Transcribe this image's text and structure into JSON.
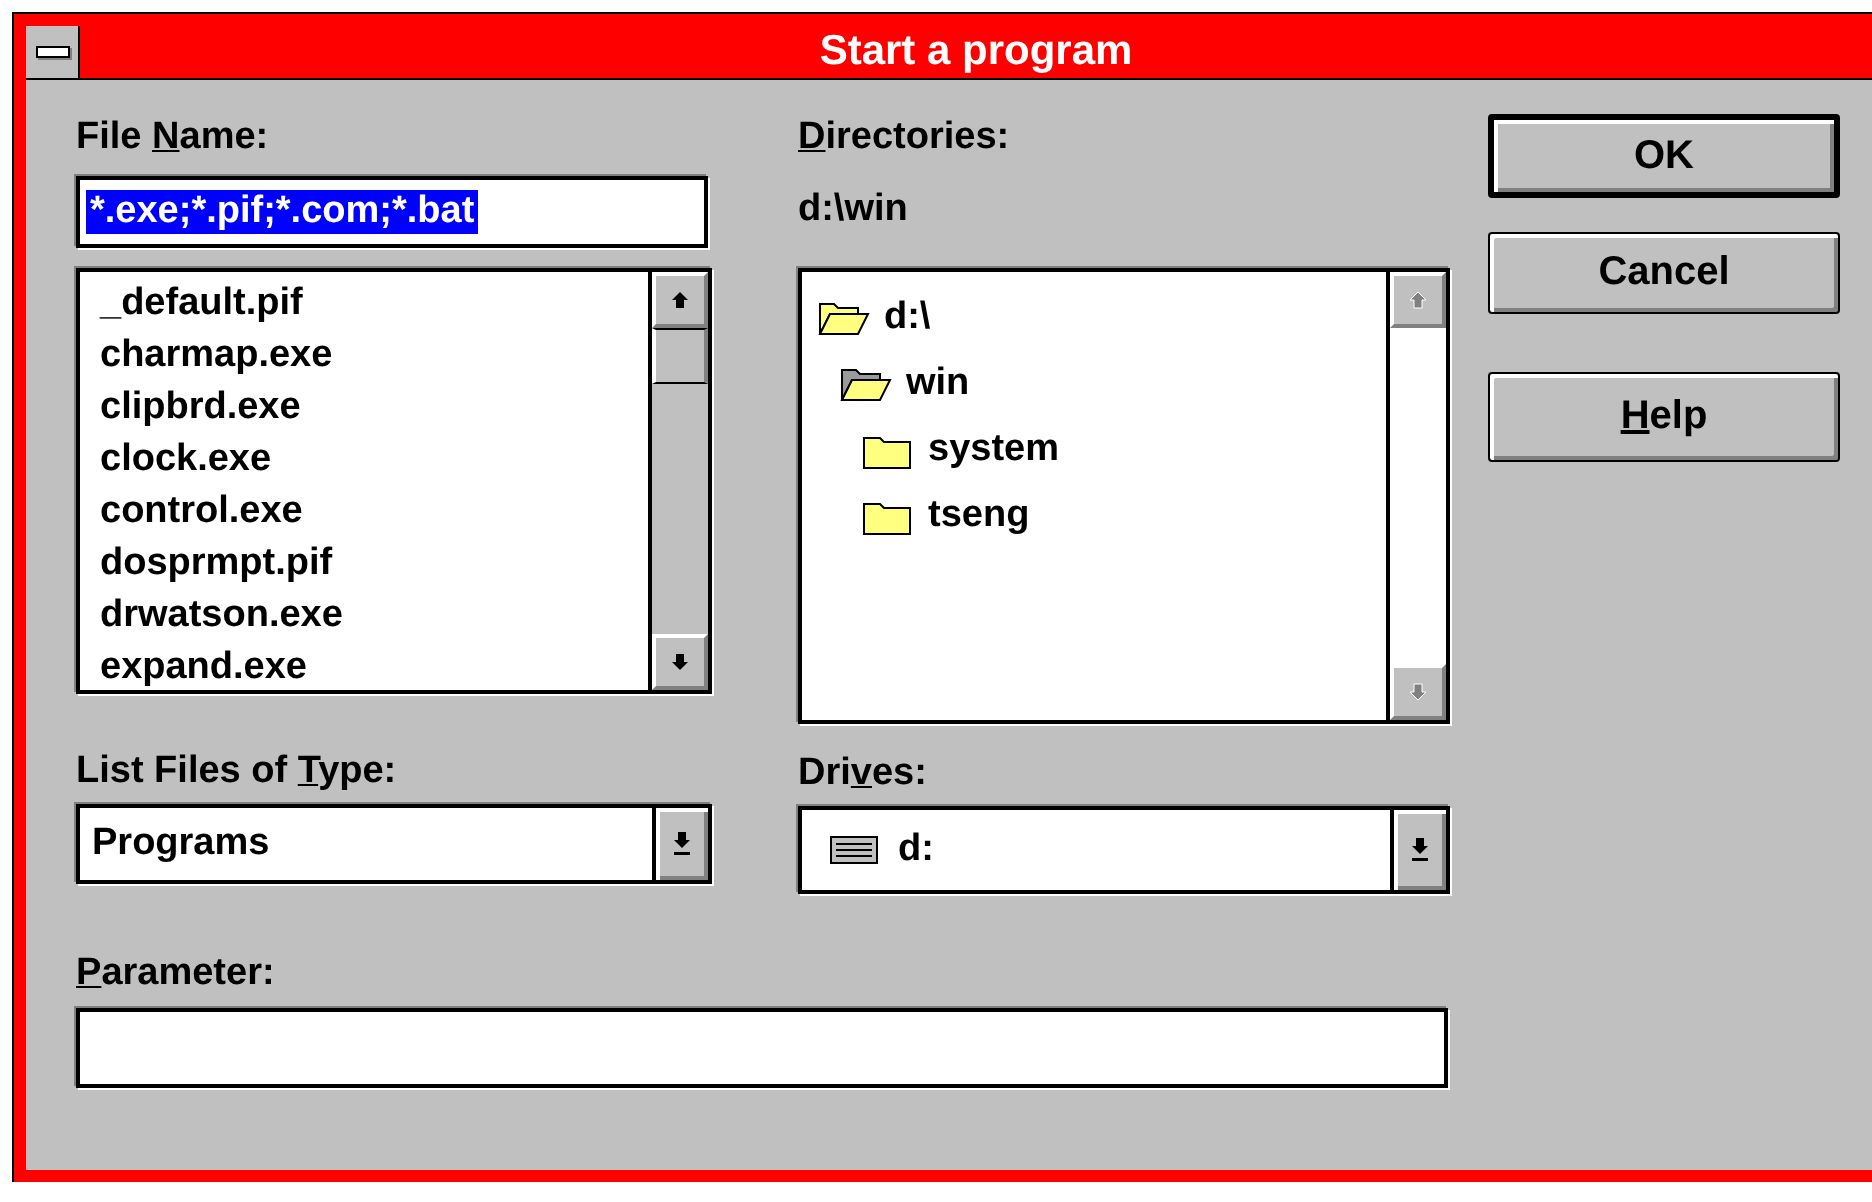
{
  "window": {
    "title": "Start a program"
  },
  "file_name": {
    "label": [
      {
        "text": "File ",
        "underline": false
      },
      {
        "text": "N",
        "underline": true
      },
      {
        "text": "ame:",
        "underline": false
      }
    ],
    "value": "*.exe;*.pif;*.com;*.bat",
    "selected": true
  },
  "files": [
    "_default.pif",
    "charmap.exe",
    "clipbrd.exe",
    "clock.exe",
    "control.exe",
    "dosprmpt.pif",
    "drwatson.exe",
    "expand.exe"
  ],
  "directories": {
    "label": [
      {
        "text": "D",
        "underline": true
      },
      {
        "text": "irectories:",
        "underline": false
      }
    ],
    "path": "d:\\win",
    "scrollbar_disabled": true,
    "tree": [
      {
        "name": "d:\\",
        "kind": "open",
        "children": [
          {
            "name": "win",
            "kind": "current",
            "children": [
              {
                "name": "system",
                "kind": "closed"
              },
              {
                "name": "tseng",
                "kind": "closed"
              }
            ]
          }
        ]
      }
    ]
  },
  "file_type": {
    "label": [
      {
        "text": "List Files of ",
        "underline": false
      },
      {
        "text": "T",
        "underline": true
      },
      {
        "text": "ype:",
        "underline": false
      }
    ],
    "value": "Programs"
  },
  "drives": {
    "label": [
      {
        "text": "Dri",
        "underline": false
      },
      {
        "text": "v",
        "underline": true
      },
      {
        "text": "es:",
        "underline": false
      }
    ],
    "value": "d:"
  },
  "parameter": {
    "label": [
      {
        "text": "P",
        "underline": true
      },
      {
        "text": "arameter:",
        "underline": false
      }
    ]
  },
  "buttons": [
    {
      "label": [
        {
          "text": "OK",
          "underline": false
        }
      ],
      "default": true
    },
    {
      "label": [
        {
          "text": "Cancel",
          "underline": false
        }
      ],
      "default": false
    },
    {
      "label": [
        {
          "text": "H",
          "underline": true
        },
        {
          "text": "elp",
          "underline": false
        }
      ],
      "default": false
    }
  ]
}
